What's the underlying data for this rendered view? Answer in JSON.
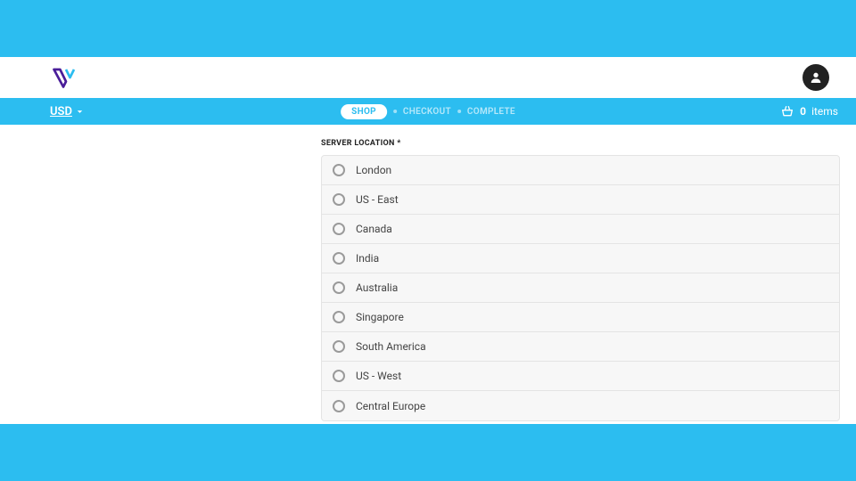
{
  "header": {
    "currency": "USD"
  },
  "steps": {
    "active": "SHOP",
    "step2": "CHECKOUT",
    "step3": "COMPLETE"
  },
  "cart": {
    "count": "0",
    "label": "items"
  },
  "section": {
    "title": "SERVER LOCATION *"
  },
  "locations": [
    {
      "label": "London"
    },
    {
      "label": "US - East"
    },
    {
      "label": "Canada"
    },
    {
      "label": "India"
    },
    {
      "label": "Australia"
    },
    {
      "label": "Singapore"
    },
    {
      "label": "South America"
    },
    {
      "label": "US - West"
    },
    {
      "label": "Central Europe"
    }
  ]
}
